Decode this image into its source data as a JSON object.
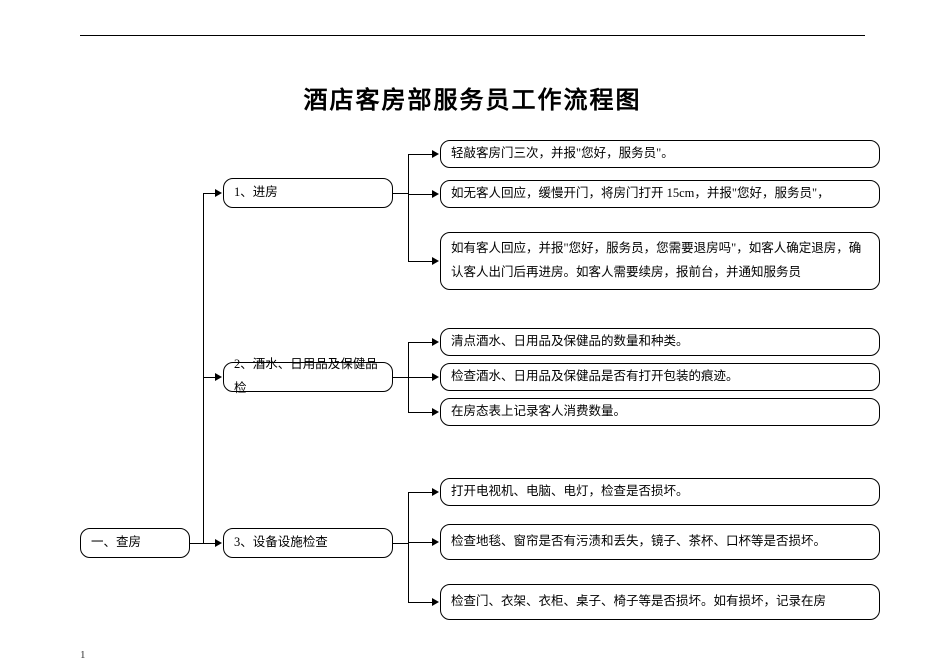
{
  "title": "酒店客房部服务员工作流程图",
  "root": "一、查房",
  "steps": {
    "s1": "1、进房",
    "s2": "2、酒水、日用品及保健品检",
    "s3": "3、设备设施检查"
  },
  "details": {
    "d1a": "轻敲客房门三次，并报\"您好，服务员\"。",
    "d1b": "如无客人回应，缓慢开门，将房门打开 15cm，并报\"您好，服务员\"，",
    "d1c": "如有客人回应，并报\"您好，服务员，您需要退房吗\"，如客人确定退房，确认客人出门后再进房。如客人需要续房，报前台，并通知服务员",
    "d2a": "清点酒水、日用品及保健品的数量和种类。",
    "d2b": "检查酒水、日用品及保健品是否有打开包装的痕迹。",
    "d2c": "在房态表上记录客人消费数量。",
    "d3a": "打开电视机、电脑、电灯，检查是否损坏。",
    "d3b": "检查地毯、窗帘是否有污渍和丢失，镜子、茶杯、口杯等是否损坏。",
    "d3c": "检查门、衣架、衣柜、桌子、椅子等是否损坏。如有损坏，记录在房"
  },
  "footnote": "1"
}
